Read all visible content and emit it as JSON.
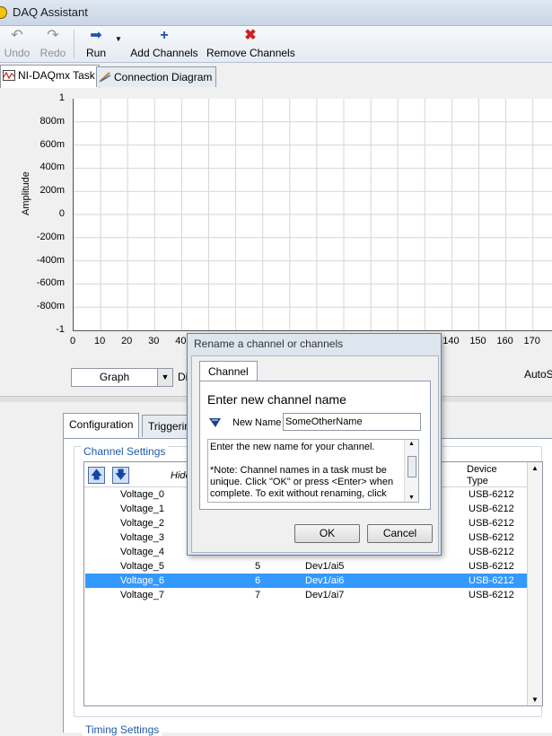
{
  "window": {
    "title": "DAQ Assistant"
  },
  "toolbar": {
    "undo_label": "Undo",
    "redo_label": "Redo",
    "run_label": "Run",
    "add_channels_label": "Add Channels",
    "remove_channels_label": "Remove Channels"
  },
  "tabs": [
    {
      "label": "NI-DAQmx Task"
    },
    {
      "label": "Connection Diagram"
    }
  ],
  "graph": {
    "ylabel": "Amplitude",
    "yticks": [
      "1",
      "800m",
      "600m",
      "400m",
      "200m",
      "0",
      "-200m",
      "-400m",
      "-600m",
      "-800m",
      "-1"
    ],
    "xticks": [
      "0",
      "10",
      "20",
      "30",
      "40",
      "140",
      "150",
      "160",
      "170"
    ],
    "display_select": "Graph",
    "display_label": "Di",
    "autoscale_label": "AutoSc"
  },
  "lower": {
    "tabs": [
      {
        "label": "Configuration"
      },
      {
        "label": "Triggerin"
      }
    ],
    "channel_settings_caption": "Channel Settings",
    "timing_settings_caption": "Timing Settings",
    "table": {
      "hide_label": "Hide",
      "device_type_header": "Device\nType",
      "rows": [
        {
          "name": "Voltage_0",
          "number": "",
          "physical": "",
          "device": "USB-6212"
        },
        {
          "name": "Voltage_1",
          "number": "",
          "physical": "",
          "device": "USB-6212"
        },
        {
          "name": "Voltage_2",
          "number": "",
          "physical": "",
          "device": "USB-6212"
        },
        {
          "name": "Voltage_3",
          "number": "",
          "physical": "",
          "device": "USB-6212"
        },
        {
          "name": "Voltage_4",
          "number": "",
          "physical": "",
          "device": "USB-6212"
        },
        {
          "name": "Voltage_5",
          "number": "5",
          "physical": "Dev1/ai5",
          "device": "USB-6212"
        },
        {
          "name": "Voltage_6",
          "number": "6",
          "physical": "Dev1/ai6",
          "device": "USB-6212"
        },
        {
          "name": "Voltage_7",
          "number": "7",
          "physical": "Dev1/ai7",
          "device": "USB-6212"
        }
      ]
    }
  },
  "dialog": {
    "title": "Rename a channel or channels",
    "tab_label": "Channel",
    "heading": "Enter new channel name",
    "name_label": "New Name",
    "name_value": "SomeOtherName",
    "description": "Enter the new name for your channel.\n\n*Note: Channel names in a task must be unique. Click \"OK\" or press <Enter> when complete. To exit without renaming, click",
    "ok_label": "OK",
    "cancel_label": "Cancel"
  },
  "colors": {
    "selection": "#3399ff",
    "caption_blue": "#1e5aa8",
    "remove_icon": "#d02020",
    "run_icon": "#1f4fb8"
  }
}
